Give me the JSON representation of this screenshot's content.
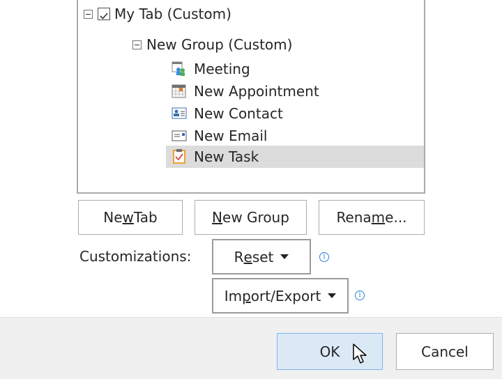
{
  "tree": {
    "tab": {
      "label": "My Tab (Custom)",
      "checked": true
    },
    "group": {
      "label": "New Group (Custom)"
    },
    "items": [
      {
        "label": "Meeting",
        "icon": "meeting-icon",
        "selected": false
      },
      {
        "label": "New Appointment",
        "icon": "calendar-icon",
        "selected": false
      },
      {
        "label": "New Contact",
        "icon": "contact-card-icon",
        "selected": false
      },
      {
        "label": "New Email",
        "icon": "email-icon",
        "selected": false
      },
      {
        "label": "New Task",
        "icon": "task-clipboard-icon",
        "selected": true
      }
    ]
  },
  "buttons": {
    "new_tab": {
      "pre": "Ne",
      "u": "w",
      "post": " Tab"
    },
    "new_group": {
      "pre": "",
      "u": "N",
      "post": "ew Group"
    },
    "rename": {
      "pre": "Rena",
      "u": "m",
      "post": "e..."
    }
  },
  "customizations": {
    "label": "Customizations:",
    "reset": {
      "pre": "R",
      "u": "e",
      "post": "set"
    },
    "import_export": {
      "pre": "Im",
      "u": "p",
      "post": "ort/Export"
    },
    "info_glyph": "i"
  },
  "footer": {
    "ok": "OK",
    "cancel": "Cancel"
  },
  "colors": {
    "selection": "#dcdcdc",
    "primary_button_bg": "#dbe9f7",
    "primary_button_border": "#7eb4ea",
    "info": "#2f7fd6",
    "task_icon": "#f0a030"
  }
}
